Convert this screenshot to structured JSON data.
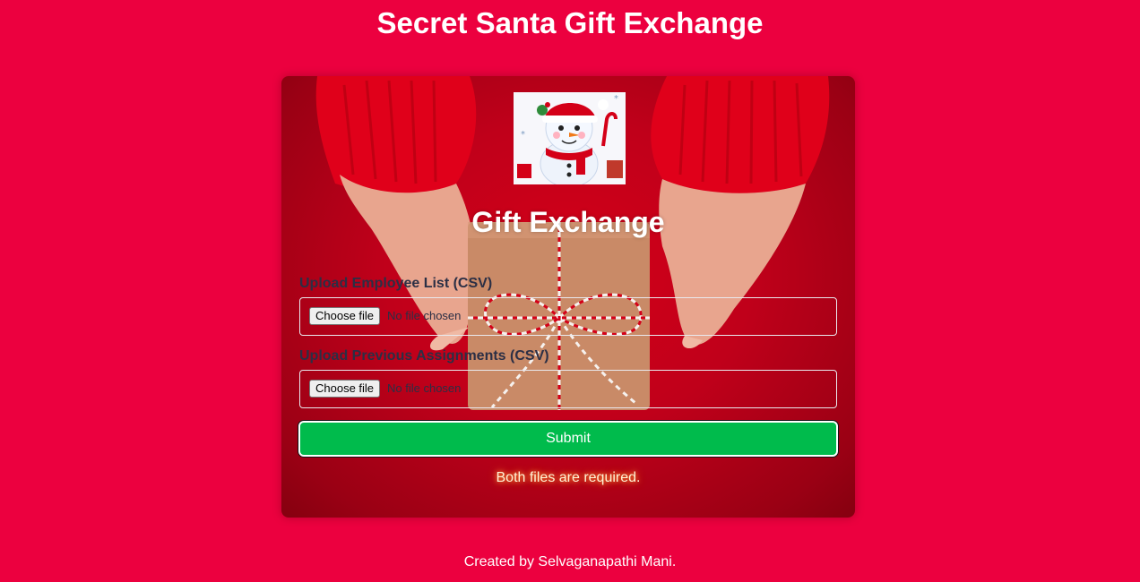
{
  "header": {
    "title": "Secret Santa Gift Exchange"
  },
  "card": {
    "title": "Gift Exchange",
    "employee_upload": {
      "label": "Upload Employee List (CSV)",
      "button": "Choose file",
      "status": "No file chosen"
    },
    "assignments_upload": {
      "label": "Upload Previous Assignments (CSV)",
      "button": "Choose file",
      "status": "No file chosen"
    },
    "submit_label": "Submit",
    "error": "Both files are required."
  },
  "footer": {
    "text": "Created by Selvaganapathi Mani."
  },
  "colors": {
    "background": "#ec003f",
    "submit": "#00bb4c",
    "label": "#2b2f45"
  },
  "icons": [
    "snowman-icon"
  ]
}
